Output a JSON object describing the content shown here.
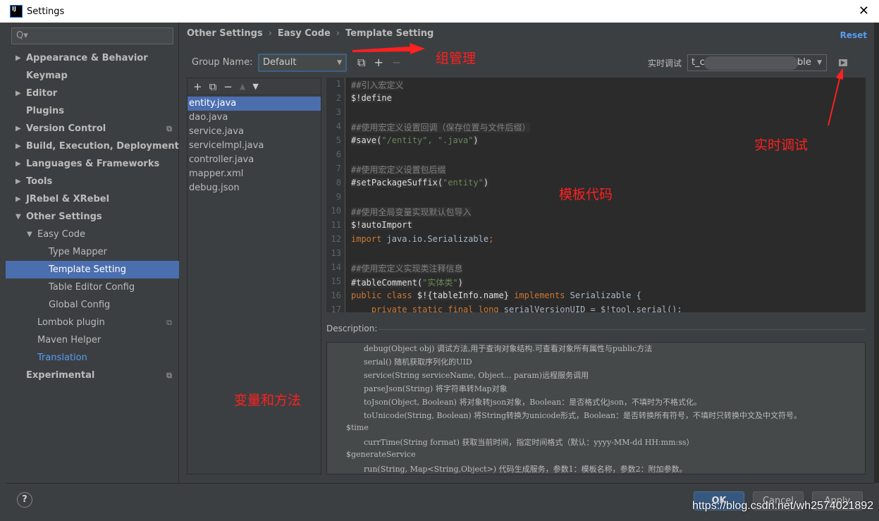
{
  "window": {
    "title": "Settings",
    "logo": "IJ",
    "close_icon": "close-icon"
  },
  "sidebar": {
    "search_placeholder": "Q▾",
    "items": [
      {
        "label": "Appearance & Behavior",
        "level": 1,
        "arrow": "▶"
      },
      {
        "label": "Keymap",
        "level": 1
      },
      {
        "label": "Editor",
        "level": 1,
        "arrow": "▶"
      },
      {
        "label": "Plugins",
        "level": 1
      },
      {
        "label": "Version Control",
        "level": 1,
        "arrow": "▶",
        "cfg": true
      },
      {
        "label": "Build, Execution, Deployment",
        "level": 1,
        "arrow": "▶"
      },
      {
        "label": "Languages & Frameworks",
        "level": 1,
        "arrow": "▶"
      },
      {
        "label": "Tools",
        "level": 1,
        "arrow": "▶"
      },
      {
        "label": "JRebel & XRebel",
        "level": 1,
        "arrow": "▶"
      },
      {
        "label": "Other Settings",
        "level": 1,
        "arrow": "▼"
      },
      {
        "label": "Easy Code",
        "level": 2,
        "arrow": "▼"
      },
      {
        "label": "Type Mapper",
        "level": 3
      },
      {
        "label": "Template Setting",
        "level": 3,
        "selected": true
      },
      {
        "label": "Table Editor Config",
        "level": 3
      },
      {
        "label": "Global Config",
        "level": 3
      },
      {
        "label": "Lombok plugin",
        "level": 2,
        "cfg": true
      },
      {
        "label": "Maven Helper",
        "level": 2
      },
      {
        "label": "Translation",
        "level": 2,
        "link": true
      },
      {
        "label": "Experimental",
        "level": 1,
        "cfg": true
      }
    ]
  },
  "breadcrumb": [
    "Other Settings",
    "Easy Code",
    "Template Setting"
  ],
  "reset_label": "Reset",
  "group": {
    "label": "Group Name:",
    "value": "Default"
  },
  "realtime": {
    "label": "实时调试",
    "value_start": "t_c",
    "value_end": "ble"
  },
  "files": [
    "entity.java",
    "dao.java",
    "service.java",
    "serviceImpl.java",
    "controller.java",
    "mapper.xml",
    "debug.json"
  ],
  "selected_file": "entity.java",
  "code": [
    [
      [
        "##引入宏定义",
        "com"
      ]
    ],
    [
      [
        "$!define",
        "mac"
      ]
    ],
    [],
    [
      [
        "##使用宏定义设置回调（保存位置与文件后缀）",
        "com"
      ]
    ],
    [
      [
        "#save(",
        "mac"
      ],
      [
        "\"/entity\", \".java\"",
        "str"
      ],
      [
        ")",
        "mac"
      ]
    ],
    [],
    [
      [
        "##使用宏定义设置包后缀",
        "com"
      ]
    ],
    [
      [
        "#setPackageSuffix(",
        "mac"
      ],
      [
        "\"entity\"",
        "str"
      ],
      [
        ")",
        "mac"
      ]
    ],
    [],
    [
      [
        "##使用全局变量实现默认包导入",
        "com"
      ]
    ],
    [
      [
        "$!autoImport",
        "mac"
      ]
    ],
    [
      [
        "import ",
        "kw"
      ],
      [
        "java.io.Serializable",
        ""
      ],
      [
        ";",
        "kw"
      ]
    ],
    [],
    [
      [
        "##使用宏定义实现类注释信息",
        "com"
      ]
    ],
    [
      [
        "#tableComment(",
        "mac"
      ],
      [
        "\"实体类\"",
        "str"
      ],
      [
        ")",
        "mac"
      ]
    ],
    [
      [
        "public class ",
        "kw"
      ],
      [
        "$!{tableInfo.name}",
        "mac"
      ],
      [
        " implements ",
        "kw"
      ],
      [
        "Serializable {",
        ""
      ]
    ],
    [
      [
        "    private static final long ",
        "kw"
      ],
      [
        "serialVersionUID = $!tool.serial();",
        ""
      ]
    ]
  ],
  "description": {
    "label": "Description:",
    "lines": [
      {
        "indent": 2,
        "text": "debug(Object obj) 调试方法,用于查询对象结构.可查看对象所有属性与public方法"
      },
      {
        "indent": 2,
        "text": "serial() 随机获取序列化的UID"
      },
      {
        "indent": 2,
        "text": "service(String serviceName, Object... param)远程服务调用"
      },
      {
        "indent": 2,
        "text": "parseJson(String) 将字符串转Map对象"
      },
      {
        "indent": 2,
        "text": "toJson(Object, Boolean) 将对象转json对象，Boolean：是否格式化json，不填时为不格式化。"
      },
      {
        "indent": 2,
        "text": "toUnicode(String, Boolean) 将String转换为unicode形式，Boolean：是否转换所有符号，不填时只转换中文及中文符号。"
      },
      {
        "indent": 1,
        "text": "$time"
      },
      {
        "indent": 2,
        "text": "currTime(String format) 获取当前时间，指定时间格式（默认：yyyy-MM-dd HH:mm:ss）"
      },
      {
        "indent": 1,
        "text": "$generateService"
      },
      {
        "indent": 2,
        "text": "run(String, Map<String,Object>) 代码生成服务，参数1：模板名称，参数2：附加参数。"
      }
    ]
  },
  "buttons": {
    "help": "?",
    "ok": "OK",
    "cancel": "Cancel",
    "apply": "Apply"
  },
  "annotations": {
    "group": "组管理",
    "realtime": "实时调试",
    "template": "模板代码",
    "vars": "变量和方法",
    "color": "#ff2020"
  },
  "watermark": "https://blog.csdn.net/wh2574021892"
}
